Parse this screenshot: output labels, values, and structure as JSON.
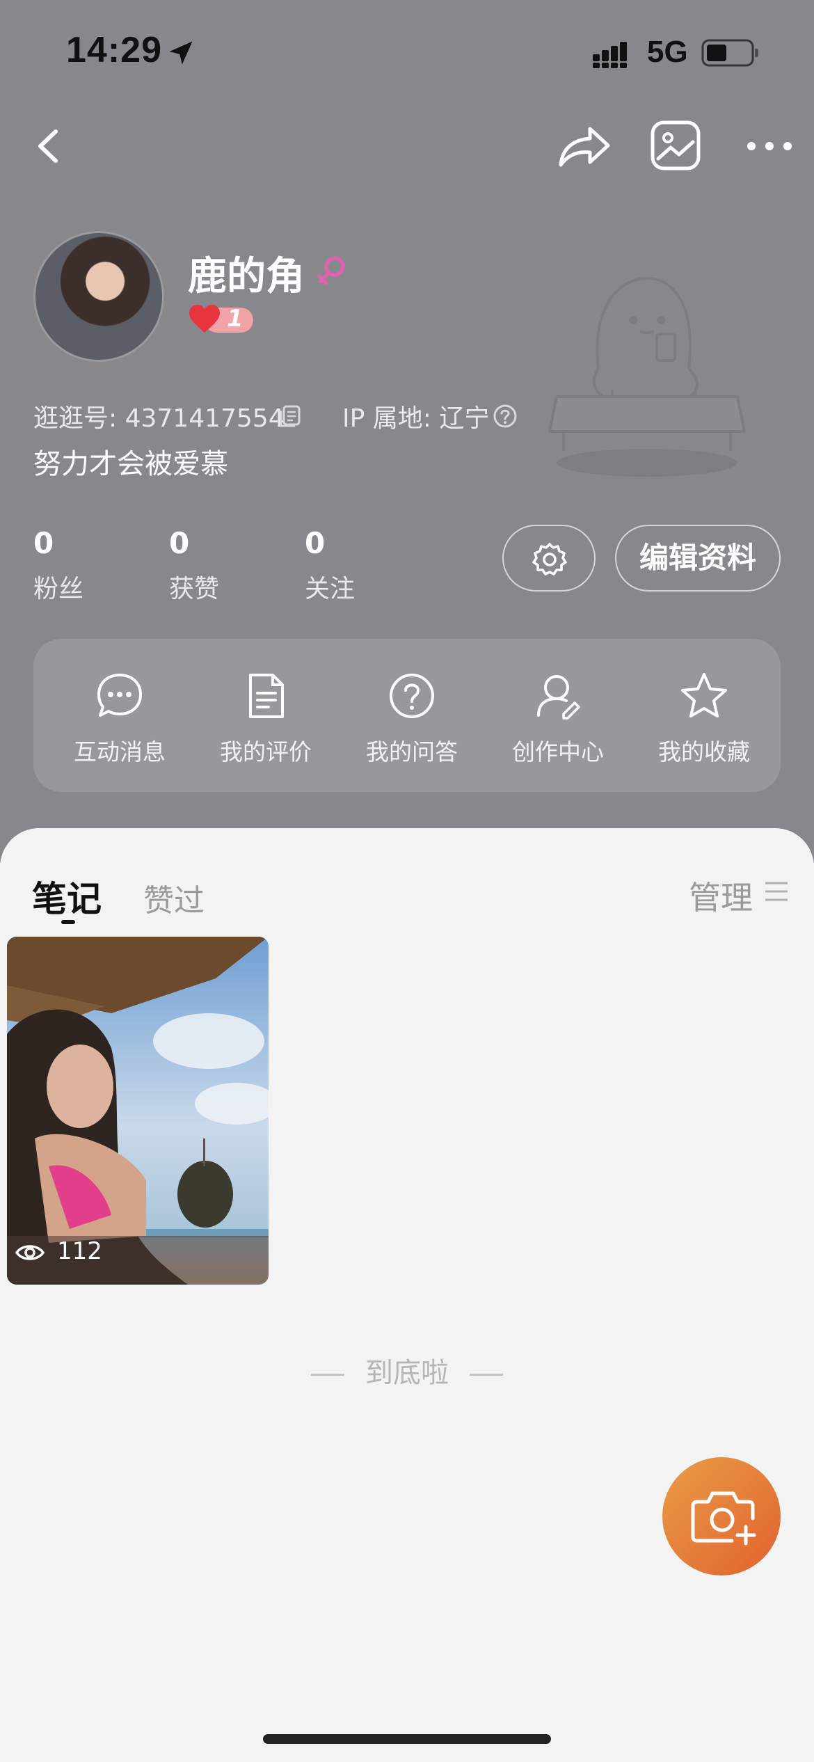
{
  "status_bar": {
    "time": "14:29",
    "network": "5G"
  },
  "profile": {
    "nickname": "鹿的角",
    "level": "1",
    "id_label": "逛逛号: 4371417554",
    "ip_label": "IP 属地: 辽宁",
    "bio": "努力才会被爱慕"
  },
  "stats": [
    {
      "value": "0",
      "label": "粉丝"
    },
    {
      "value": "0",
      "label": "获赞"
    },
    {
      "value": "0",
      "label": "关注"
    }
  ],
  "actions": {
    "edit_profile": "编辑资料"
  },
  "quick_menu": [
    {
      "label": "互动消息",
      "icon": "chat-bubble-icon"
    },
    {
      "label": "我的评价",
      "icon": "document-icon"
    },
    {
      "label": "我的问答",
      "icon": "question-icon"
    },
    {
      "label": "创作中心",
      "icon": "creator-icon"
    },
    {
      "label": "我的收藏",
      "icon": "star-icon"
    }
  ],
  "tabs": {
    "notes": "笔记",
    "liked": "赞过",
    "manage": "管理"
  },
  "notes": [
    {
      "views": "112"
    }
  ],
  "end_text": "到底啦",
  "colors": {
    "header_bg": "#88888c",
    "accent_fab_start": "#e99d47",
    "accent_fab_end": "#e1622f",
    "female_pink": "#e45fb0"
  }
}
